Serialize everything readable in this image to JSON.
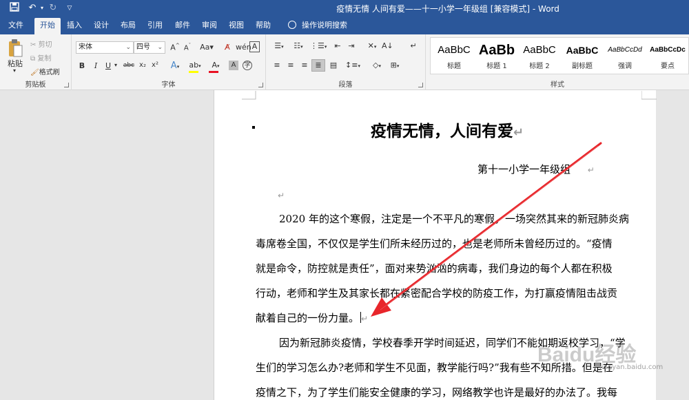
{
  "titlebar": {
    "title": "疫情无情 人间有爱——十一小学一年级组 [兼容模式]  -  Word",
    "save_icon": "save-icon",
    "undo_icon": "undo-icon",
    "redo_icon": "redo-icon",
    "customize_icon": "customize-quick-access-icon"
  },
  "tabs": [
    "文件",
    "开始",
    "插入",
    "设计",
    "布局",
    "引用",
    "邮件",
    "审阅",
    "视图",
    "帮助"
  ],
  "tell_me": "操作说明搜索",
  "ribbon": {
    "clipboard": {
      "label": "剪贴板",
      "paste": "粘贴",
      "cut": "剪切",
      "copy": "复制",
      "format_painter": "格式刷"
    },
    "font": {
      "label": "字体",
      "font_name": "宋体",
      "font_size": "四号",
      "grow": "A^",
      "shrink": "Aˇ",
      "change_case": "Aa",
      "bold": "B",
      "italic": "I",
      "underline": "U",
      "strike": "abc",
      "subscript": "x₂",
      "superscript": "x²",
      "font_color_hex": "#e81123",
      "highlight_color_hex": "#ffff00"
    },
    "paragraph": {
      "label": "段落"
    },
    "styles": {
      "label": "样式",
      "items": [
        {
          "sample": "AaBbC",
          "name": "标题"
        },
        {
          "sample": "AaBb",
          "name": "标题 1"
        },
        {
          "sample": "AaBbC",
          "name": "标题 2"
        },
        {
          "sample": "AaBbC",
          "name": "副标题"
        },
        {
          "sample": "AaBbCcDd",
          "name": "强调"
        },
        {
          "sample": "AaBbCcDc",
          "name": "要点"
        }
      ]
    }
  },
  "document": {
    "title": "疫情无情，人间有爱",
    "author": "第十一小学一年级组",
    "para_mark": "↵",
    "lines": [
      "2020 年的这个寒假，注定是一个不平凡的寒假，一场突然其来的新冠肺炎病",
      "毒席卷全国，不仅仅是学生们所未经历过的，也是老师所未曾经历过的。“疫情",
      "就是命令，防控就是责任”，面对来势汹汹的病毒，我们身边的每个人都在积极",
      "行动，老师和学生及其家长都在紧密配合学校的防疫工作，为打赢疫情阻击战贡",
      "献着自己的一份力量。",
      "因为新冠肺炎疫情，学校春季开学时间延迟，同学们不能如期返校学习，“学",
      "生们的学习怎么办?老师和学生不见面，教学能行吗?”我有些不知所措。但是在",
      "疫情之下，为了学生们能安全健康的学习，网络教学也许是最好的办法了。我每"
    ]
  },
  "watermark": {
    "text": "Baidu经验",
    "url_text": "jingyan.baidu.com"
  },
  "colors": {
    "accent": "#2b579a",
    "arrow": "#e8262b"
  }
}
